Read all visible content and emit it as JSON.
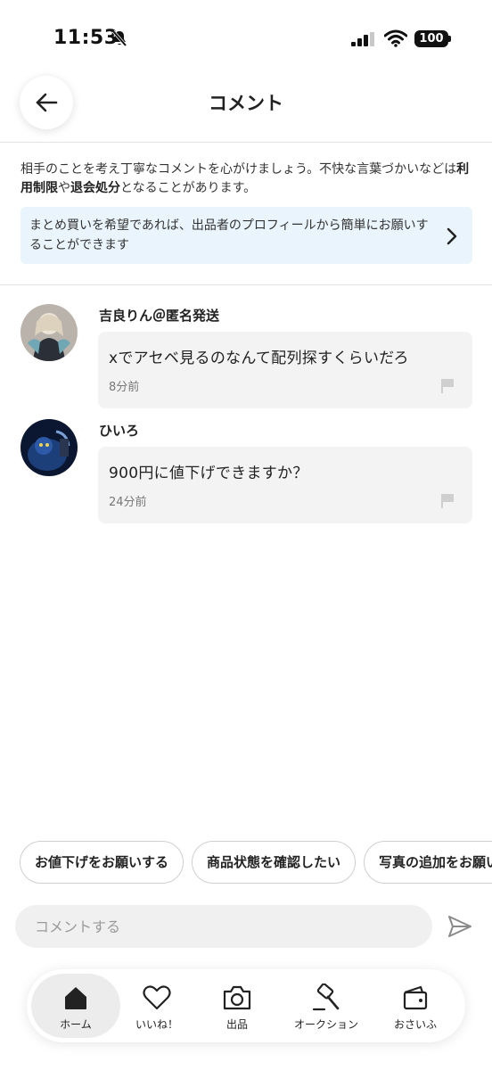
{
  "status_bar": {
    "time": "11:53",
    "battery": "100"
  },
  "header": {
    "title": "コメント",
    "back_icon": "arrow-left-icon"
  },
  "notice": {
    "text_1": "相手のことを考え丁寧なコメントを心がけましょう。不快な言葉づかいなどは",
    "bold_1": "利用制限",
    "text_2": "や",
    "bold_2": "退会処分",
    "text_3": "となることがあります。"
  },
  "info_banner": {
    "text": "まとめ買いを希望であれば、出品者のプロフィールから簡単にお願いすることができます"
  },
  "comments": [
    {
      "author": "吉良りん＠匿名発送",
      "text": "xでアセベ見るのなんて配列探すくらいだろ",
      "time": "8分前"
    },
    {
      "author": "ひいろ",
      "text": "900円に値下げできますか？",
      "time": "24分前"
    }
  ],
  "quick_replies": [
    "お値下げをお願いする",
    "商品状態を確認したい",
    "写真の追加をお願いしたい"
  ],
  "comment_input": {
    "placeholder": "コメントする"
  },
  "tab_bar": {
    "tabs": [
      {
        "label": "ホーム",
        "icon": "home-icon",
        "active": true
      },
      {
        "label": "いいね！",
        "icon": "heart-icon",
        "active": false
      },
      {
        "label": "出品",
        "icon": "camera-icon",
        "active": false
      },
      {
        "label": "オークション",
        "icon": "gavel-icon",
        "active": false
      },
      {
        "label": "おさいふ",
        "icon": "wallet-icon",
        "active": false
      }
    ]
  },
  "colors": {
    "banner_bg": "#e9f4fc",
    "bubble_bg": "#f3f3f3",
    "active_tab_bg": "#ececec"
  }
}
